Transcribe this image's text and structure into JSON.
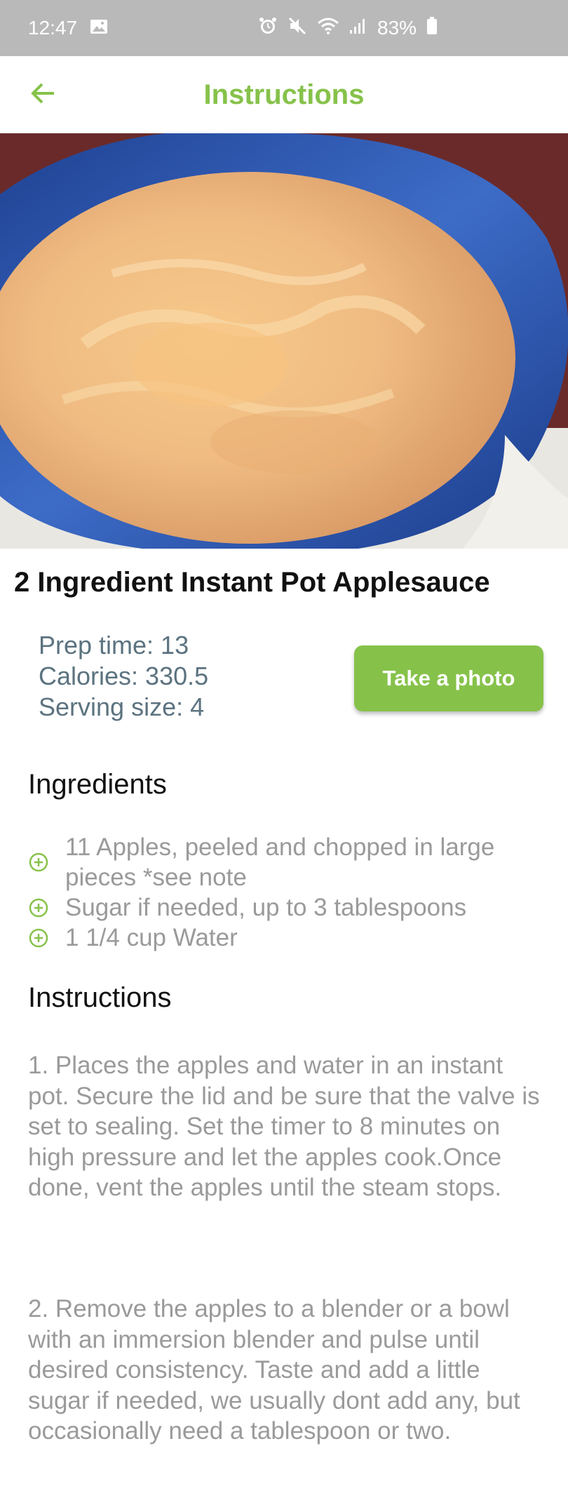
{
  "status_bar": {
    "time": "12:47",
    "battery": "83%",
    "icons": [
      "image-icon",
      "alarm-icon",
      "mute-icon",
      "wifi-icon",
      "signal-icon",
      "battery-icon"
    ]
  },
  "app_bar": {
    "title": "Instructions",
    "back_icon": "arrow-left-icon"
  },
  "colors": {
    "accent": "#86c24a",
    "meta_text": "#5c7380",
    "body_text": "#9a9a9a",
    "status_bar": "#b9b9b9"
  },
  "recipe": {
    "title": "2 Ingredient Instant Pot Applesauce",
    "prep_time": "Prep time: 13",
    "calories": "Calories: 330.5",
    "serving_size": "Serving size: 4",
    "photo_button": "Take a photo"
  },
  "ingredients": {
    "heading": "Ingredients",
    "items": [
      "11 Apples, peeled and chopped in large pieces *see note",
      "Sugar if needed, up to 3 tablespoons",
      "1 1/4 cup Water"
    ]
  },
  "instructions": {
    "heading": "Instructions",
    "steps": [
      "1. Places the apples and water in an instant pot. Secure the lid and be sure that the valve is set to sealing. Set the timer to 8 minutes on high pressure and let the apples cook.Once done, vent the apples until the steam stops.",
      "2. Remove the apples to a blender or a bowl with an immersion blender and pulse until desired consistency. Taste and add a little sugar if needed, we usually dont add any, but occasionally need a tablespoon or two."
    ]
  }
}
